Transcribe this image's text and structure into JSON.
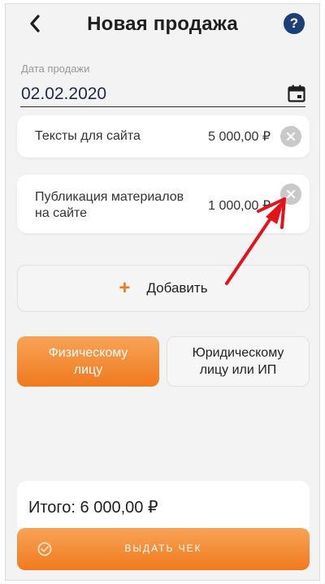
{
  "header": {
    "title": "Новая продажа",
    "back_icon": "chevron-left-icon",
    "help_label": "?"
  },
  "sale_date": {
    "label": "Дата продажи",
    "value": "02.02.2020",
    "icon": "calendar-icon"
  },
  "items": [
    {
      "name": "Тексты для сайта",
      "price": "5 000,00 ₽"
    },
    {
      "name_line1": "Публикация материалов",
      "name_line2": "на сайте",
      "price": "1 000,00 ₽"
    }
  ],
  "add_button": {
    "plus": "+",
    "label": "Добавить"
  },
  "customer_type": {
    "individual": {
      "line1": "Физическому",
      "line2": "лицу",
      "selected": true
    },
    "legal": {
      "line1": "Юридическому",
      "line2": "лицу или ИП",
      "selected": false
    }
  },
  "total": {
    "text": "Итого: 6 000,00 ₽"
  },
  "issue_button": {
    "label": "ВЫДАТЬ ЧЕК"
  },
  "colors": {
    "accent": "#f07a1e",
    "help_bg": "#1c3f7a",
    "annotation": "#e3121b"
  }
}
